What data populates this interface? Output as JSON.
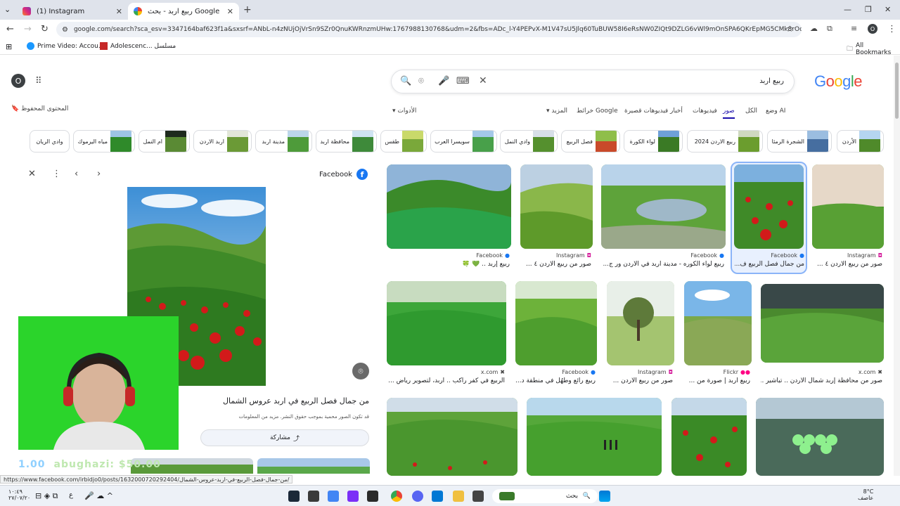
{
  "browser": {
    "tabs": [
      {
        "label": "(1) Instagram",
        "icon": "instagram-icon"
      },
      {
        "label": "ربيع اربد - بحث Google",
        "icon": "google-icon"
      }
    ],
    "url": "google.com/search?sca_esv=3347164baf623f1a&sxsrf=ANbL-n4zNUjOjVrSn9SZr0QnuKWRnzmUHw:1767988130768&udm=2&fbs=ADc_l-Y4PEPvX-M1V47sU5Jlq60TuBUW58I6eRsNW0ZIQt9DZLG6vWl9mOnSPA6QKrEpMG5CMk8rOoBFH92_b8...",
    "bookmarks": [
      "Prime Video: Accou...",
      "Adolescenc... مسلسل"
    ],
    "all_bookmarks": "All Bookmarks",
    "profile_letter": "O"
  },
  "google": {
    "logo": "Google",
    "query": "ربيع اربد",
    "avatar_letter": "O",
    "saved_label": "المحتوى المحفوظ",
    "nav": {
      "ai": "وضع AI",
      "all": "الكل",
      "images": "صور",
      "videos": "فيديوهات",
      "news": "أخبار",
      "shorts": "فيديوهات قصيرة",
      "maps": "خرائط Google",
      "more": "المزيد",
      "tools": "الأدوات"
    },
    "chips": [
      "الأردن",
      "الشجرة الرمثا",
      "ربيع الاردن 2024",
      "لواء الكورة",
      "فصل الربيع",
      "وادي النمل",
      "سويسرا العرب",
      "طقس",
      "محافظة اربد",
      "مدينة اربد",
      "اربد الاردن",
      "ام النمل",
      "مياه اليرموك",
      "وادي الريان"
    ]
  },
  "preview": {
    "source": "Facebook",
    "title": "من جمال فصل الربيع في اربد عروس الشمال",
    "note": "قد تكون الصور محمية بموجب حقوق النشر. مزيد من المعلومات",
    "share": "مشاركة"
  },
  "results_row1": [
    {
      "source": "Facebook",
      "caption": "ربيع إربد .. 💚 🍀"
    },
    {
      "source": "Instagram",
      "caption": "صور من ربيع الاردن ٤ ..."
    },
    {
      "source": "Facebook",
      "caption": "ربيع لواء الكوره - مدينة اربد في الأردن ور ج..."
    },
    {
      "source": "Facebook",
      "caption": "من جمال فصل الربيع ف..."
    },
    {
      "source": "Instagram",
      "caption": "صور من ربيع الاردن ٤ ..."
    }
  ],
  "results_row2": [
    {
      "source": "x.com",
      "caption": "الربيع في كفر راكب .. اربد، لتصوير رياض ..."
    },
    {
      "source": "Facebook",
      "caption": "ربيع رائع وطُهُل في منطقة د..."
    },
    {
      "source": "Instagram",
      "caption": "صور من ربيع الاردن ..."
    },
    {
      "source": "Flickr",
      "caption": "ربيع اربد | صورة من ..."
    },
    {
      "source": "x.com",
      "caption": "صور من محافظة إربد شمال الأردن .. تباشير ..."
    }
  ],
  "overlay_text": "abughazi: $50.00",
  "overlay_prefix": "1.00",
  "status_url": "https://www.facebook.com/irbidjo0/posts/1632000720292404/من-جمال-فصل-الربيع-في-اربد-عروس-الشمال/",
  "taskbar": {
    "search": "بحث",
    "weather_temp": "8°C",
    "weather_desc": "عاصف",
    "time": "١٠:٤٩",
    "date": "٢٧/٠٧/٢٠"
  },
  "colors": {
    "google_blue": "#4285f4",
    "google_red": "#ea4335",
    "google_yellow": "#fbbc05",
    "google_green": "#34a853",
    "facebook": "#1877f2",
    "webcam_green": "#2bd42b"
  }
}
